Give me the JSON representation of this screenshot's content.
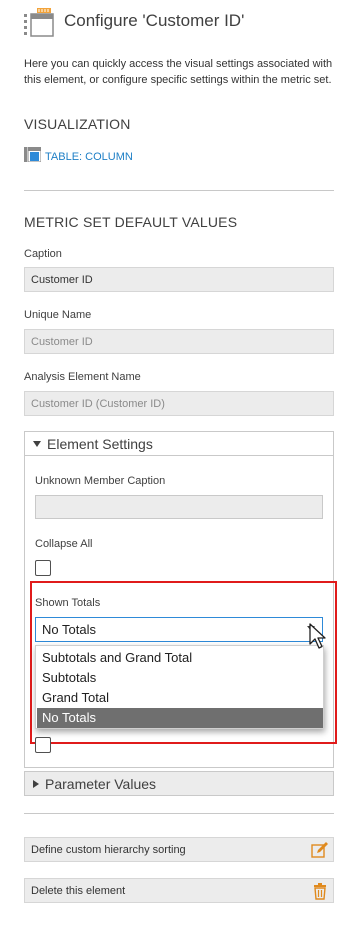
{
  "header": {
    "title": "Configure 'Customer ID'",
    "icon": "table-column-settings-icon",
    "description": "Here you can quickly access the visual settings associated with this element, or configure specific settings within the metric set."
  },
  "visualization": {
    "heading": "VISUALIZATION",
    "link_label": "TABLE: COLUMN",
    "link_icon": "table-column-icon"
  },
  "metric_set": {
    "heading": "METRIC SET DEFAULT VALUES",
    "caption_label": "Caption",
    "caption_value": "Customer ID",
    "unique_name_label": "Unique Name",
    "unique_name_value": "Customer ID",
    "analysis_label": "Analysis Element Name",
    "analysis_value": "Customer ID (Customer ID)"
  },
  "element_settings": {
    "header": "Element Settings",
    "expanded": true,
    "unknown_caption_label": "Unknown Member Caption",
    "unknown_caption_value": "",
    "collapse_all_label": "Collapse All",
    "collapse_all_checked": false,
    "shown_totals_label": "Shown Totals",
    "shown_totals_value": "No Totals",
    "shown_totals_options": [
      "Subtotals and Grand Total",
      "Subtotals",
      "Grand Total",
      "No Totals"
    ],
    "hidden_checkbox_checked": false
  },
  "parameter_values": {
    "header": "Parameter Values",
    "expanded": false
  },
  "actions": {
    "custom_sorting_label": "Define custom hierarchy sorting",
    "custom_sorting_icon": "edit-pencil-icon",
    "delete_label": "Delete this element",
    "delete_icon": "trash-icon"
  },
  "colors": {
    "link": "#1e7fc6",
    "highlight_border": "#e01b1b",
    "focus_border": "#2e8ad8",
    "selected_option_bg": "#6f6f6f",
    "edit_icon": "#e08a1e",
    "delete_icon": "#e08a1e"
  }
}
